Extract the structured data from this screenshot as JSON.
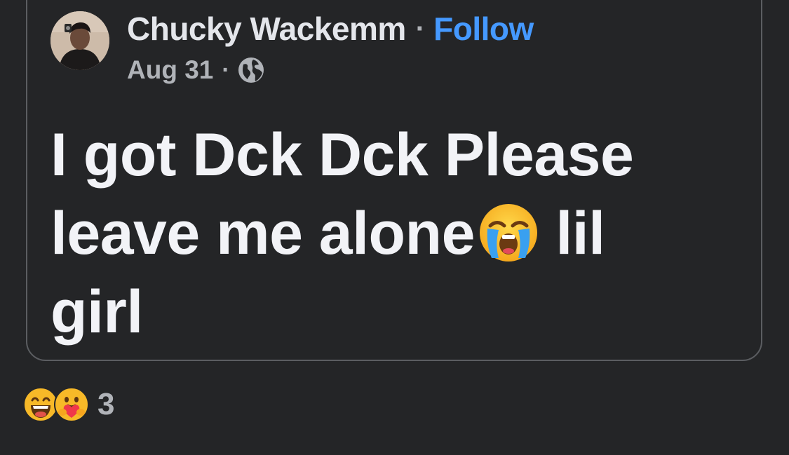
{
  "post": {
    "author": {
      "name": "Chucky Wackemm",
      "separator": "·",
      "follow_label": "Follow"
    },
    "meta": {
      "date": "Aug 31",
      "separator": "·",
      "audience_icon": "globe-icon"
    },
    "body_lines": [
      "I got Dck Dck Please",
      "leave me alone",
      " lil",
      "girl"
    ],
    "body_emoji": "loudly-crying-face-emoji"
  },
  "reactions": {
    "icons": [
      "haha-reaction-icon",
      "care-reaction-icon"
    ],
    "count": "3"
  },
  "colors": {
    "background": "#242527",
    "card_border": "#5b5d61",
    "primary_text": "#f2f3f7",
    "secondary_text": "#b0b3b8",
    "link": "#4599ff"
  }
}
